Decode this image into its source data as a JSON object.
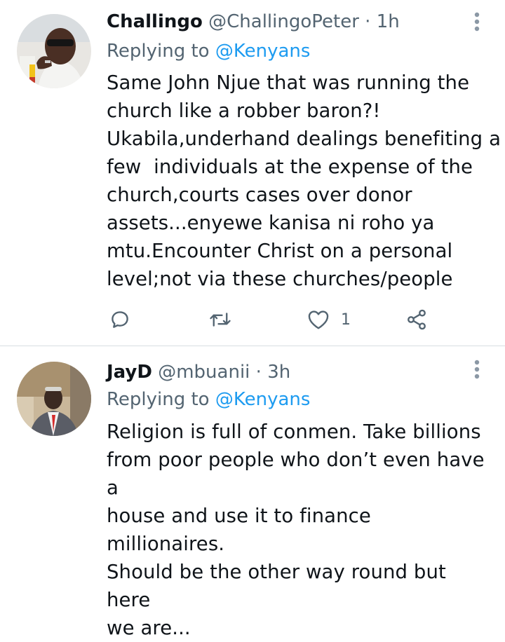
{
  "tweets": [
    {
      "display_name": "Challingo",
      "handle": "@ChallingoPeter",
      "separator": " · ",
      "time": "1h",
      "replying_prefix": "Replying to ",
      "replying_to": "@Kenyans",
      "lines": [
        "Same John Njue that was running the",
        "church like a robber baron?!",
        "Ukabila,underhand dealings benefiting a",
        "few  individuals at the expense of the",
        "church,courts cases over donor",
        "assets...enyewe kanisa ni roho ya",
        "mtu.Encounter Christ on a personal",
        "level;not via these churches/people"
      ],
      "like_count": "1"
    },
    {
      "display_name": "JayD",
      "handle": "@mbuanii",
      "separator": " · ",
      "time": "3h",
      "replying_prefix": "Replying to ",
      "replying_to": "@Kenyans",
      "lines": [
        "Religion is full of conmen. Take billions",
        "from poor people who don’t even have a",
        "house and use it to finance millionaires.",
        "Should be the other way round but here",
        "we are..."
      ]
    }
  ],
  "icons": {
    "reply": "reply-icon",
    "retweet": "retweet-icon",
    "like": "heart-icon",
    "share": "share-icon",
    "more": "more-vertical-icon"
  },
  "colors": {
    "link": "#1d9bf0",
    "secondary_text": "#536471",
    "primary_text": "#0f1419",
    "divider": "#d8dee2"
  }
}
